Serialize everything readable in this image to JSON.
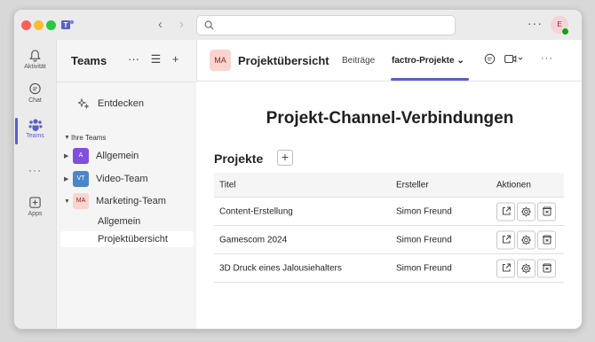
{
  "titlebar": {
    "search_placeholder": "",
    "more_label": "···",
    "me_initial": "E"
  },
  "rail": {
    "items": [
      {
        "label": "Aktivität",
        "icon": "bell-icon"
      },
      {
        "label": "Chat",
        "icon": "chat-icon"
      },
      {
        "label": "Teams",
        "icon": "teams-icon"
      },
      {
        "label": "···",
        "icon": "more-icon"
      },
      {
        "label": "Apps",
        "icon": "apps-icon"
      }
    ]
  },
  "sidebar": {
    "title": "Teams",
    "actions": [
      "···",
      "☰",
      "+"
    ],
    "discover": "Entdecken",
    "section": "Ihre Teams",
    "teams": [
      {
        "abbr": "A",
        "name": "Allgemein",
        "color": "#7f4fe0"
      },
      {
        "abbr": "VT",
        "name": "Video-Team",
        "color": "#4a86c8"
      },
      {
        "abbr": "MA",
        "name": "Marketing-Team",
        "color": "#fbd4d0"
      }
    ],
    "channels": [
      "Allgemein",
      "Projektübersicht"
    ]
  },
  "channel": {
    "avatar": "MA",
    "title": "Projektübersicht",
    "tabs": [
      "Beiträge",
      "factro-Projekte ⌄"
    ]
  },
  "content": {
    "heading": "Projekt-Channel-Verbindungen",
    "projects_label": "Projekte",
    "add_label": "+",
    "columns": [
      "Titel",
      "Ersteller",
      "Aktionen"
    ],
    "rows": [
      {
        "title": "Content-Erstellung",
        "creator": "Simon Freund"
      },
      {
        "title": "Gamescom 2024",
        "creator": "Simon Freund"
      },
      {
        "title": "3D Druck eines Jalousiehalters",
        "creator": "Simon Freund"
      }
    ]
  },
  "colors": {
    "accent": "#5b5fc7",
    "status_online": "#13a10e"
  }
}
